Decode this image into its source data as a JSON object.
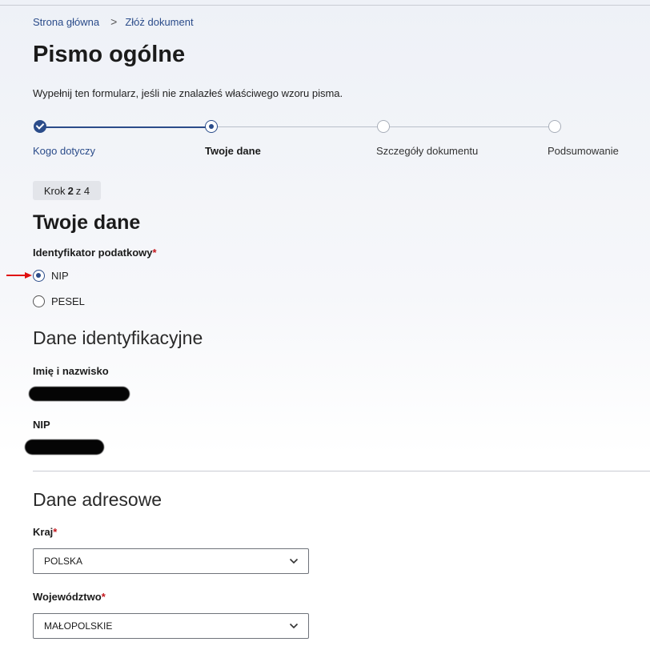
{
  "breadcrumb": {
    "home": "Strona główna",
    "separator": ">",
    "current": "Złóż dokument"
  },
  "page": {
    "title": "Pismo ogólne",
    "subtitle": "Wypełnij ten formularz, jeśli nie znalazłeś właściwego wzoru pisma."
  },
  "stepper": {
    "steps": [
      {
        "label": "Kogo dotyczy",
        "state": "done"
      },
      {
        "label": "Twoje dane",
        "state": "current"
      },
      {
        "label": "Szczegóły dokumentu",
        "state": "todo"
      },
      {
        "label": "Podsumowanie",
        "state": "todo"
      }
    ],
    "badge": {
      "prefix": "Krok",
      "current": "2",
      "middle": "z",
      "total": "4"
    }
  },
  "form": {
    "section_title": "Twoje dane",
    "tax_id": {
      "label": "Identyfikator podatkowy",
      "required_mark": "*",
      "options": [
        {
          "label": "NIP",
          "checked": true
        },
        {
          "label": "PESEL",
          "checked": false
        }
      ]
    },
    "identification": {
      "title": "Dane identyfikacyjne",
      "name_label": "Imię i nazwisko",
      "nip_label": "NIP"
    },
    "address": {
      "title": "Dane adresowe",
      "country_label": "Kraj",
      "country_value": "POLSKA",
      "voivodeship_label": "Województwo",
      "voivodeship_value": "MAŁOPOLSKIE",
      "required_mark": "*"
    }
  },
  "colors": {
    "accent": "#2b4c8a",
    "required": "#c4161c",
    "annotation_arrow": "#e01010"
  }
}
